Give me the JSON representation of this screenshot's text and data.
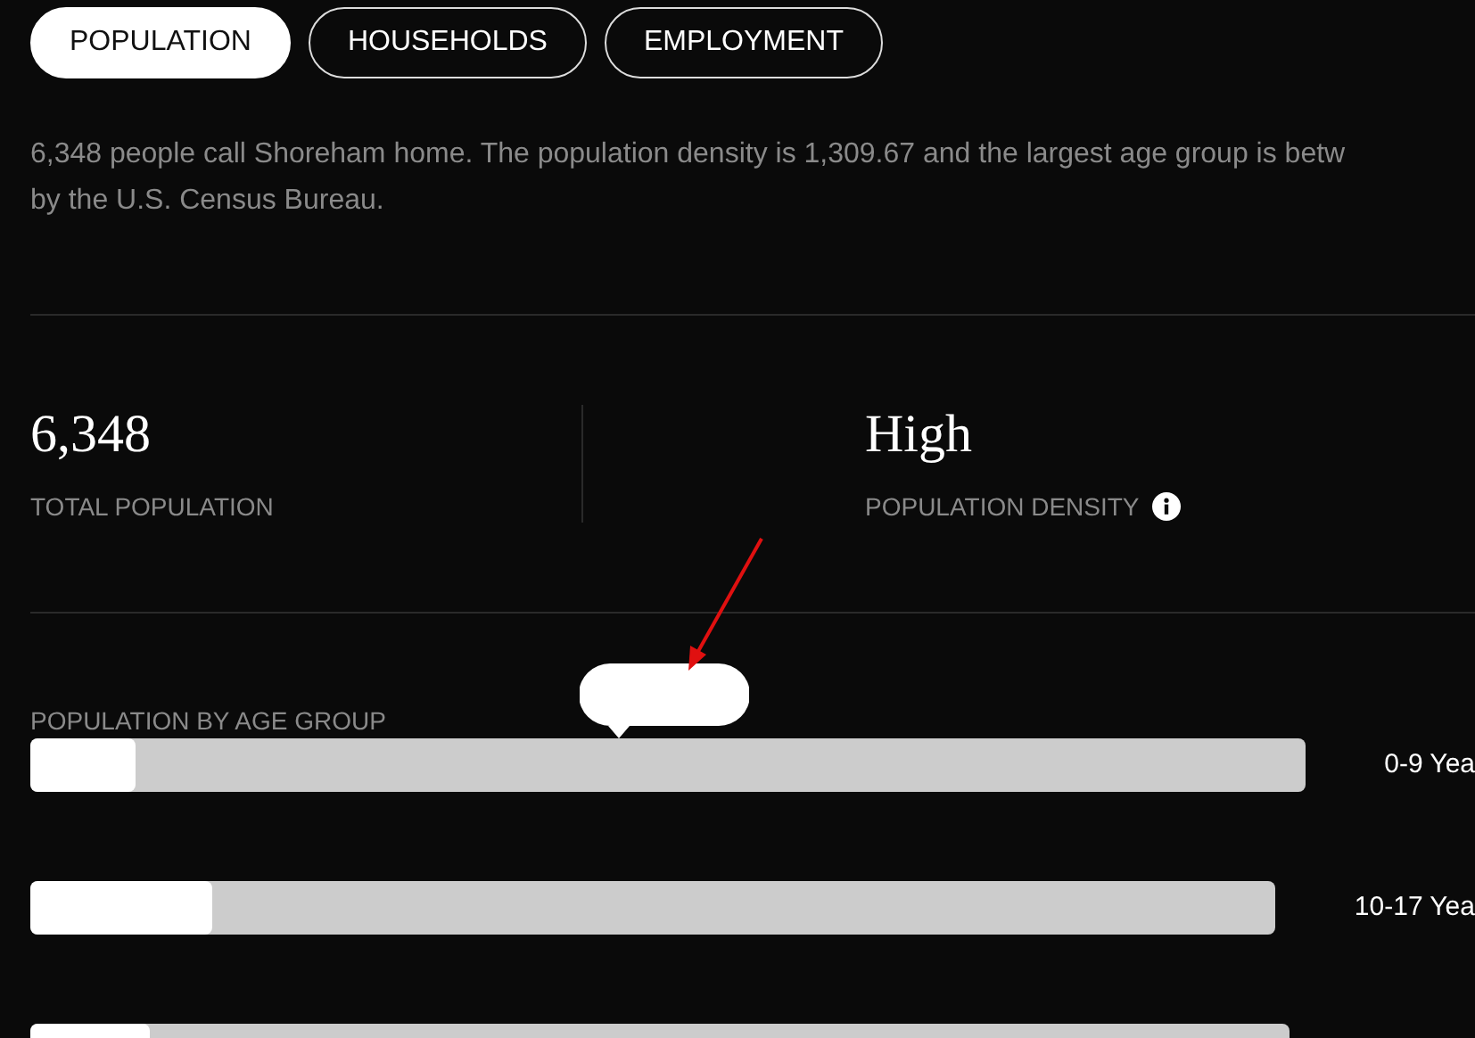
{
  "tabs": [
    {
      "label": "POPULATION",
      "selected": true
    },
    {
      "label": "HOUSEHOLDS",
      "selected": false
    },
    {
      "label": "EMPLOYMENT",
      "selected": false
    }
  ],
  "description": "6,348 people call Shoreham home. The population density is 1,309.67 and the largest age group is betw\nby the U.S. Census Bureau.",
  "stats": [
    {
      "value": "6,348",
      "label": "TOTAL POPULATION",
      "info": false
    },
    {
      "value": "High",
      "label": "POPULATION DENSITY",
      "info": true
    }
  ],
  "age_group": {
    "title": "POPULATION BY AGE GROUP",
    "bars": [
      {
        "label": "0-9 Yea",
        "level": 0.083
      },
      {
        "label": "10-17 Yea",
        "level": 0.146
      },
      {
        "level": 0.095
      }
    ]
  }
}
